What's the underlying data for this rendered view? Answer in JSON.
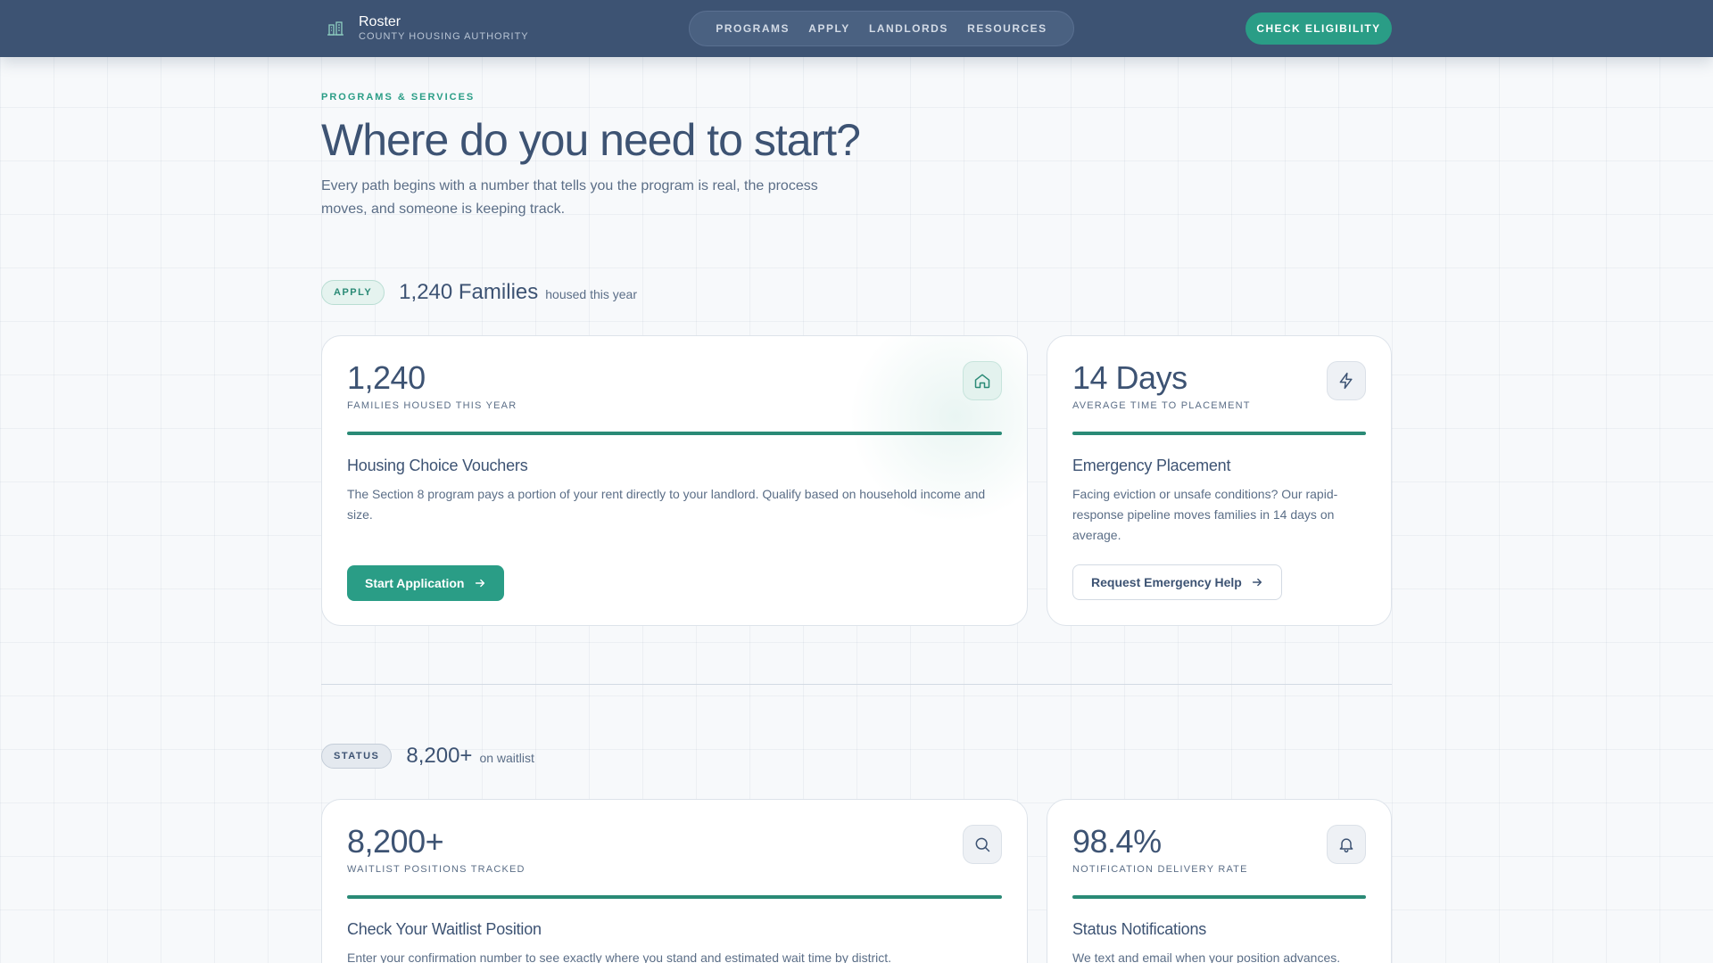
{
  "header": {
    "brand_name": "Roster",
    "brand_sub": "COUNTY HOUSING AUTHORITY",
    "nav": [
      "PROGRAMS",
      "APPLY",
      "LANDLORDS",
      "RESOURCES"
    ],
    "cta": "CHECK ELIGIBILITY",
    "colors": {
      "bar": "#3d5373",
      "accent": "#2a9d86"
    }
  },
  "hero": {
    "eyebrow": "PROGRAMS & SERVICES",
    "title": "Where do you need to start?",
    "description": "Every path begins with a number that tells you the program is real, the process moves, and someone is keeping track."
  },
  "sections": [
    {
      "pill": "APPLY",
      "headline": "1,240 Families",
      "subline": "housed this year",
      "cards": [
        {
          "stat": "1,240",
          "label": "FAMILIES HOUSED THIS YEAR",
          "icon": "home-icon",
          "title": "Housing Choice Vouchers",
          "description": "The Section 8 program pays a portion of your rent directly to your landlord. Qualify based on household income and size.",
          "button": "Start Application"
        },
        {
          "stat": "14 Days",
          "label": "AVERAGE TIME TO PLACEMENT",
          "icon": "lightning-icon",
          "title": "Emergency Placement",
          "description": "Facing eviction or unsafe conditions? Our rapid-response pipeline moves families in 14 days on average.",
          "button": "Request Emergency Help"
        }
      ]
    },
    {
      "pill": "STATUS",
      "headline": "8,200+",
      "subline": "on waitlist",
      "cards": [
        {
          "stat": "8,200+",
          "label": "WAITLIST POSITIONS TRACKED",
          "icon": "search-icon",
          "title": "Check Your Waitlist Position",
          "description": "Enter your confirmation number to see exactly where you stand and estimated wait time by district."
        },
        {
          "stat": "98.4%",
          "label": "NOTIFICATION DELIVERY RATE",
          "icon": "bell-icon",
          "title": "Status Notifications",
          "description": "We text and email when your position advances."
        }
      ]
    }
  ]
}
